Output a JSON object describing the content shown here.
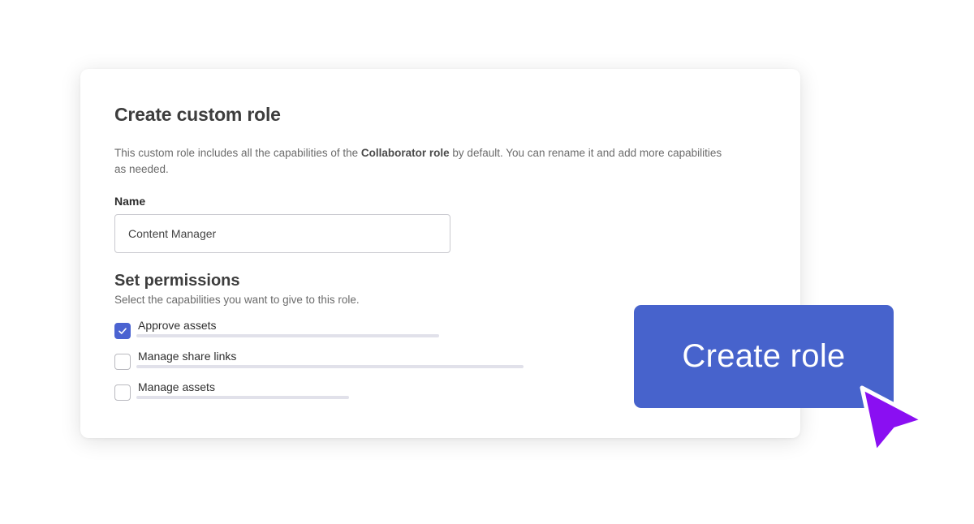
{
  "dialog": {
    "title": "Create custom role",
    "description_prefix": "This custom role includes all the capabilities of the ",
    "description_bold": "Collaborator role",
    "description_suffix": " by default. You can rename it and add more capabilities as needed.",
    "name_label": "Name",
    "name_value": "Content Manager",
    "permissions_title": "Set permissions",
    "permissions_description": "Select the capabilities you want to give to this role.",
    "permissions": [
      {
        "label": "Approve assets",
        "checked": true
      },
      {
        "label": "Manage share links",
        "checked": false
      },
      {
        "label": "Manage assets",
        "checked": false
      }
    ]
  },
  "create_button_label": "Create role",
  "colors": {
    "accent": "#4763cc",
    "checkbox_checked": "#4b63d1",
    "cursor": "#8a0ff2"
  },
  "icons": {
    "checkmark": "check-icon",
    "pointer": "mouse-pointer-icon"
  }
}
